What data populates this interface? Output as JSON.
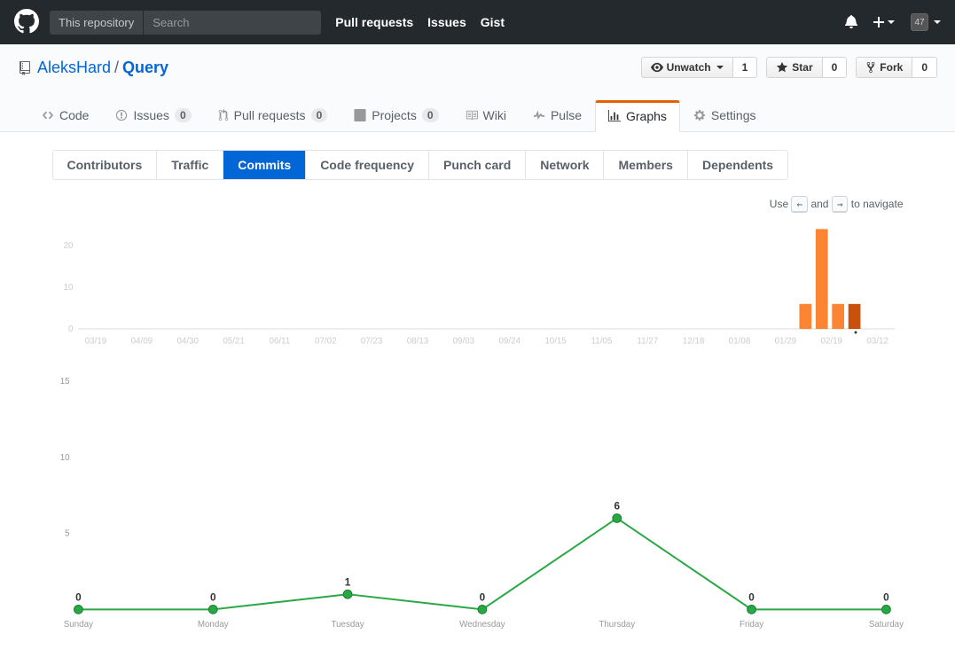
{
  "header": {
    "context": "This repository",
    "search_placeholder": "Search",
    "nav": {
      "pulls": "Pull requests",
      "issues": "Issues",
      "gist": "Gist"
    },
    "avatar_text": "47"
  },
  "repo": {
    "owner": "AleksHard",
    "name": "Query",
    "actions": {
      "unwatch": "Unwatch",
      "unwatch_count": "1",
      "star": "Star",
      "star_count": "0",
      "fork": "Fork",
      "fork_count": "0"
    }
  },
  "reponav": {
    "code": "Code",
    "issues": "Issues",
    "issues_count": "0",
    "pulls": "Pull requests",
    "pulls_count": "0",
    "projects": "Projects",
    "projects_count": "0",
    "wiki": "Wiki",
    "pulse": "Pulse",
    "graphs": "Graphs",
    "settings": "Settings"
  },
  "subnav": {
    "contributors": "Contributors",
    "traffic": "Traffic",
    "commits": "Commits",
    "code_frequency": "Code frequency",
    "punch_card": "Punch card",
    "network": "Network",
    "members": "Members",
    "dependents": "Dependents"
  },
  "hint": {
    "use": "Use",
    "and": "and",
    "nav": "to navigate",
    "left": "←",
    "right": "→"
  },
  "chart_data": [
    {
      "type": "bar",
      "title": "",
      "xlabel": "",
      "ylabel": "",
      "ylim": [
        0,
        24
      ],
      "y_ticks": [
        0,
        10,
        20
      ],
      "categories": [
        "03/19",
        "04/09",
        "04/30",
        "05/21",
        "06/11",
        "07/02",
        "07/23",
        "08/13",
        "09/03",
        "09/24",
        "10/15",
        "11/05",
        "11/27",
        "12/18",
        "01/08",
        "01/29",
        "02/19",
        "03/12"
      ],
      "values_weeks": [
        {
          "x": 0.883,
          "v": 6,
          "dark": false
        },
        {
          "x": 0.903,
          "v": 24,
          "dark": false
        },
        {
          "x": 0.923,
          "v": 6,
          "dark": false
        },
        {
          "x": 0.943,
          "v": 6,
          "dark": true
        }
      ]
    },
    {
      "type": "line",
      "title": "",
      "xlabel": "",
      "ylabel": "",
      "ylim": [
        0,
        16
      ],
      "y_ticks": [
        5,
        10,
        15
      ],
      "categories": [
        "Sunday",
        "Monday",
        "Tuesday",
        "Wednesday",
        "Thursday",
        "Friday",
        "Saturday"
      ],
      "values": [
        0,
        0,
        1,
        0,
        6,
        0,
        0
      ]
    }
  ]
}
